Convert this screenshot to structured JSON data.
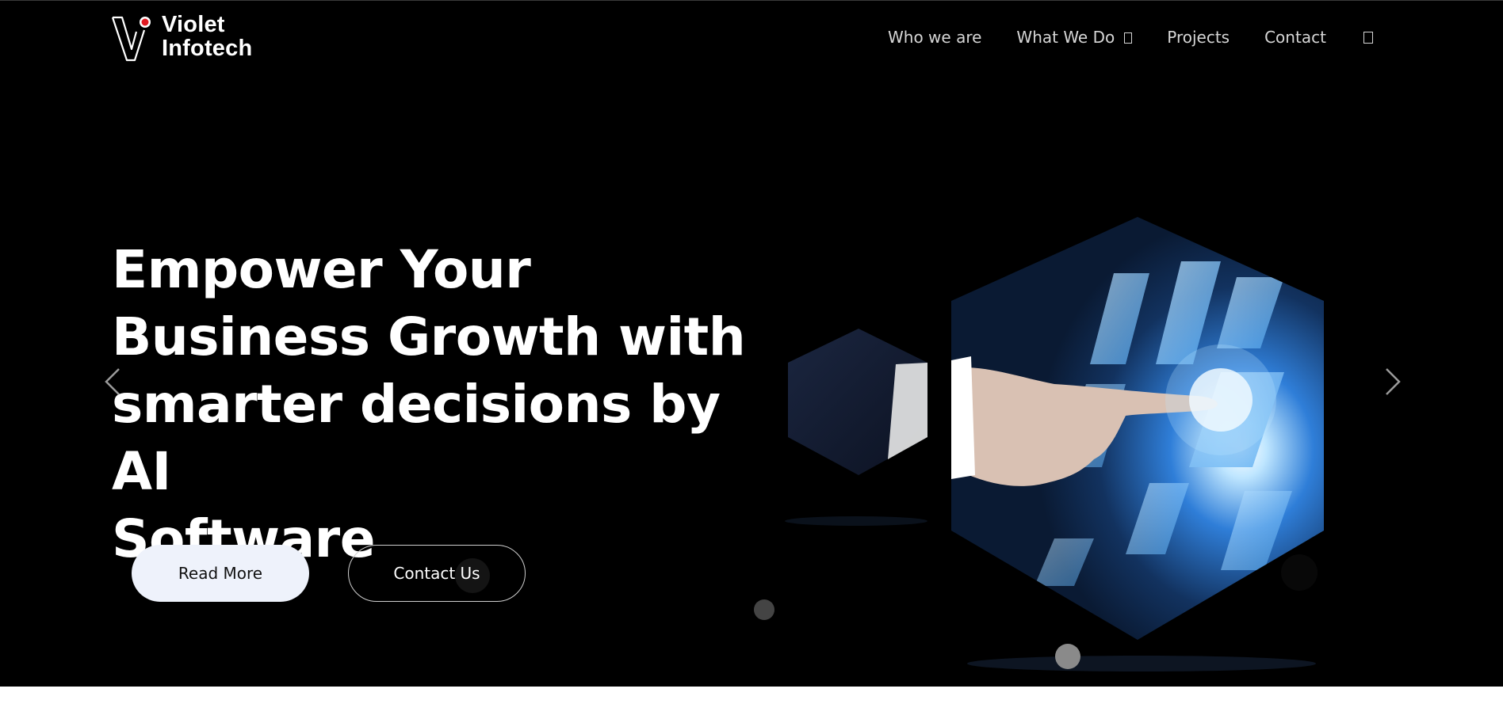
{
  "brand": {
    "line1": "Violet",
    "line2": "Infotech",
    "accent_color": "#e21b23"
  },
  "nav": {
    "items": [
      {
        "label": "Who we are"
      },
      {
        "label": "What We Do",
        "icon": "dropdown-icon"
      },
      {
        "label": "Projects"
      },
      {
        "label": "Contact"
      }
    ],
    "trailing_icon": "search-icon"
  },
  "hero": {
    "headline_lines": [
      "Empower Your",
      "Business Growth with",
      "smarter decisions by AI",
      "Software"
    ],
    "buttons": {
      "read_more": "Read More",
      "contact_us": "Contact Us"
    },
    "carousel": {
      "prev_icon": "chevron-left-icon",
      "next_icon": "chevron-right-icon",
      "dot_count": 2
    },
    "image": "hand-touching-hexagon-screen-illustration"
  },
  "colors": {
    "hero_background": "#000000",
    "button_light": "#eef2fb",
    "text": "#ffffff",
    "nav_text": "#d6d6d6"
  }
}
